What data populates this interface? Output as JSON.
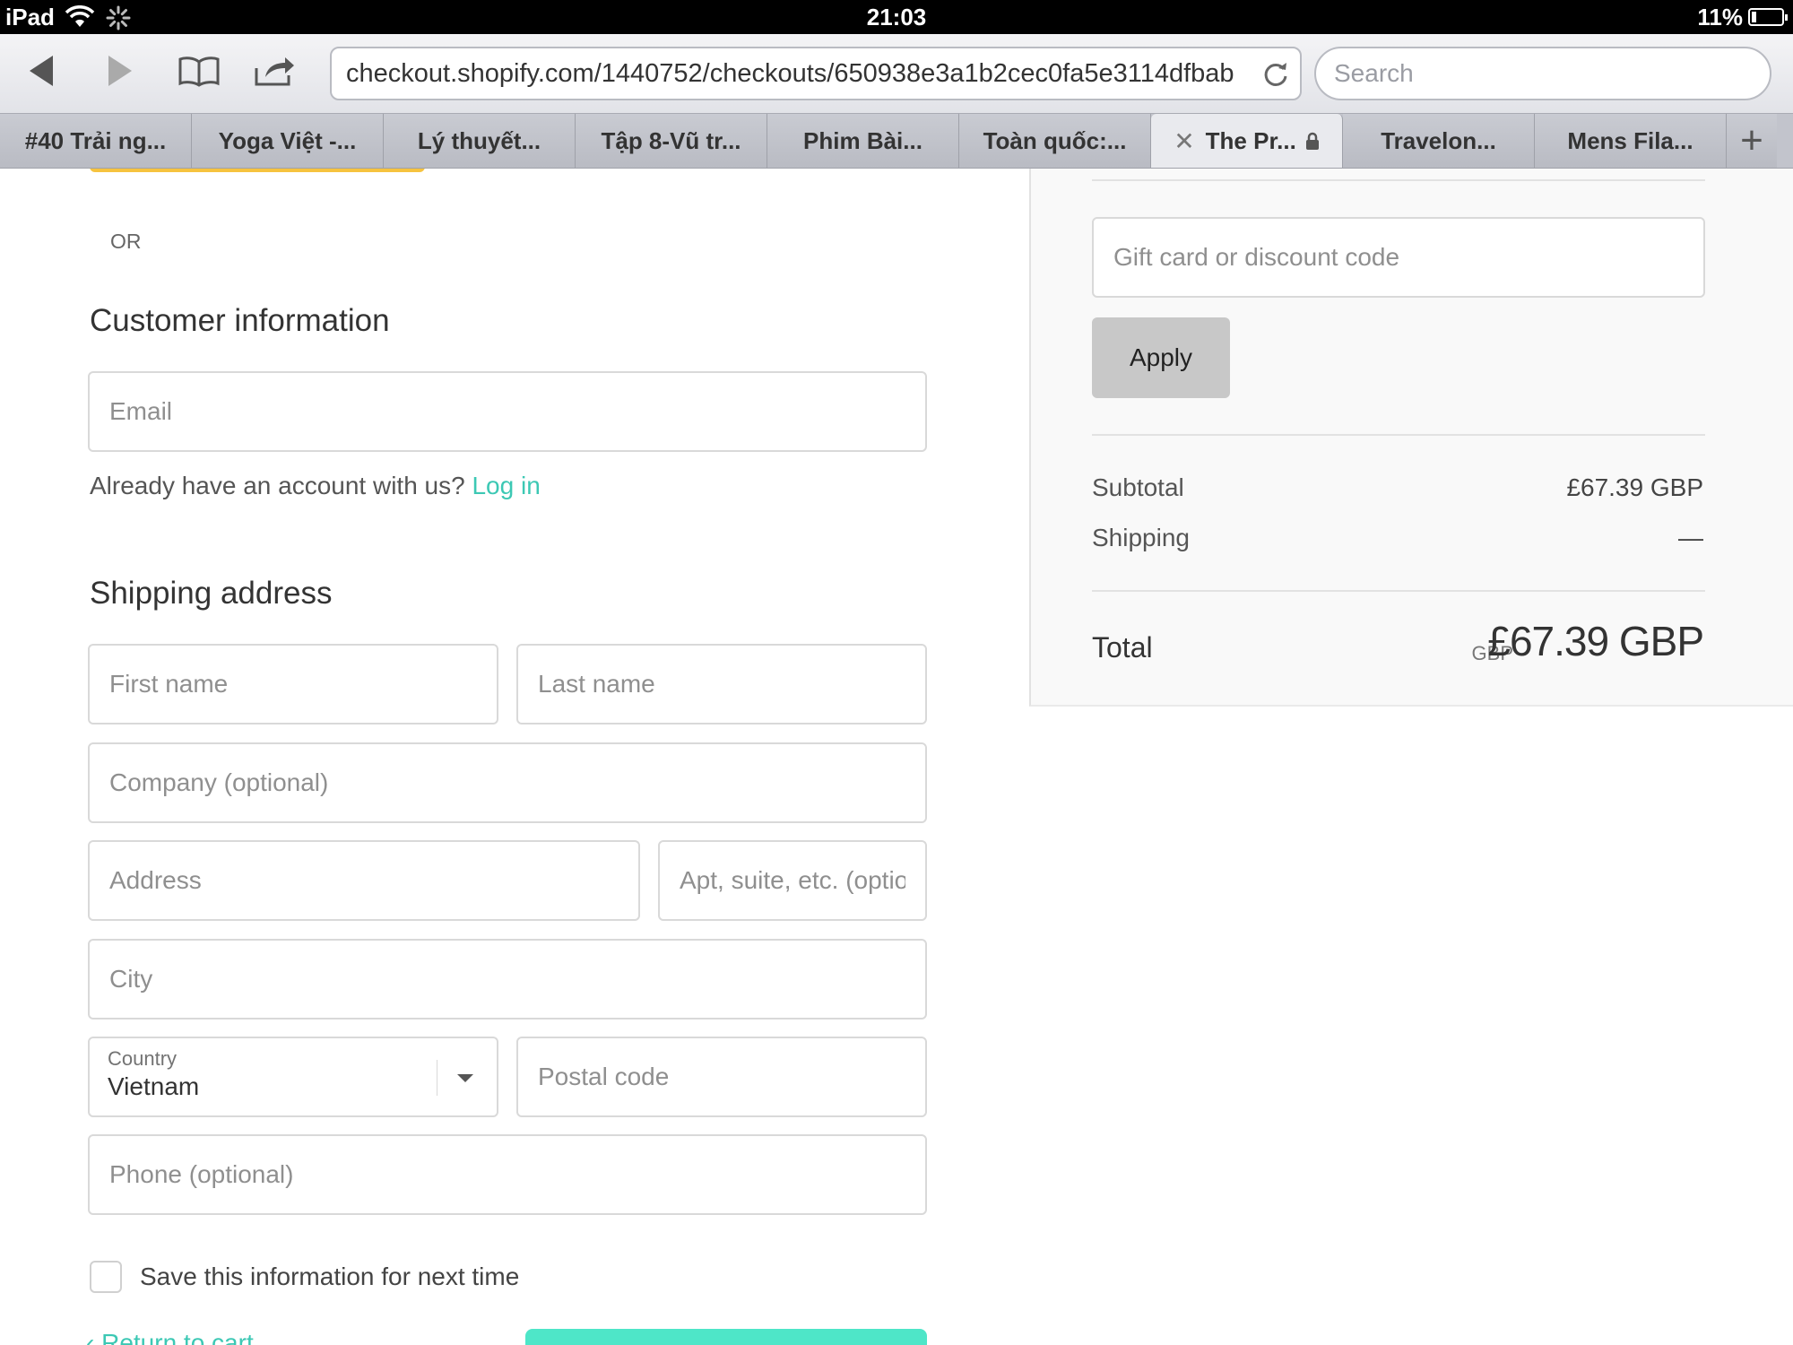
{
  "status_bar": {
    "device": "iPad",
    "time": "21:03",
    "battery": "11%"
  },
  "browser": {
    "url": "checkout.shopify.com/1440752/checkouts/650938e3a1b2cec0fa5e3114dfbab",
    "search_placeholder": "Search",
    "tabs": [
      {
        "label": "#40 Trải ng..."
      },
      {
        "label": "Yoga Việt -..."
      },
      {
        "label": "Lý thuyết..."
      },
      {
        "label": "Tập 8-Vũ tr..."
      },
      {
        "label": "Phim Bài..."
      },
      {
        "label": "Toàn quốc:..."
      },
      {
        "label": "The Pr..."
      },
      {
        "label": "Travelon..."
      },
      {
        "label": "Mens Fila..."
      }
    ],
    "new_tab": "+",
    "close_tab": "✕"
  },
  "checkout": {
    "or_label": "OR",
    "customer_title": "Customer information",
    "email_placeholder": "Email",
    "account_prompt": "Already have an account with us?",
    "login_link": "Log in",
    "shipping_title": "Shipping address",
    "first_name_placeholder": "First name",
    "last_name_placeholder": "Last name",
    "company_placeholder": "Company (optional)",
    "address_placeholder": "Address",
    "apt_placeholder": "Apt, suite, etc. (optional)",
    "city_placeholder": "City",
    "country_label": "Country",
    "country_value": "Vietnam",
    "postal_placeholder": "Postal code",
    "phone_placeholder": "Phone (optional)",
    "save_info_label": "Save this information for next time",
    "return_link": "‹ Return to cart"
  },
  "summary": {
    "gift_placeholder": "Gift card or discount code",
    "apply_label": "Apply",
    "subtotal_label": "Subtotal",
    "subtotal_value": "£67.39 GBP",
    "shipping_label": "Shipping",
    "shipping_value": "—",
    "total_label": "Total",
    "total_currency": "GBP",
    "total_value": "£67.39 GBP"
  },
  "colors": {
    "accent": "#3cc8b4",
    "pay_button": "#f6c33f",
    "continue_button": "#4ee6c8"
  }
}
